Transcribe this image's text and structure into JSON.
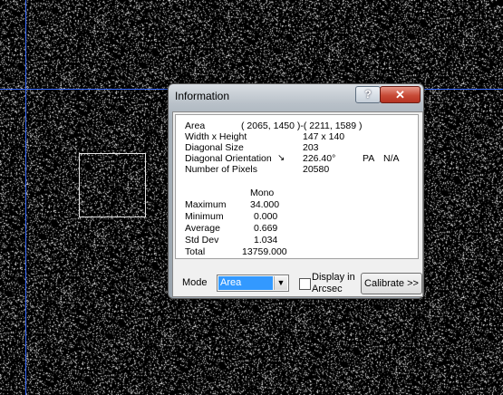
{
  "canvas": {
    "guide_color": "#3a6cff"
  },
  "dialog": {
    "title": "Information",
    "help_label": "?",
    "close_label": "✕",
    "rows": [
      {
        "label": "Area",
        "value": "( 2065, 1450 )-( 2211, 1589 )"
      },
      {
        "label": "Width x Height",
        "value": "147 x 140"
      },
      {
        "label": "Diagonal Size",
        "value": "203"
      },
      {
        "label": "Diagonal Orientation",
        "value": "226.40°",
        "extra1": "PA",
        "extra2": "N/A"
      },
      {
        "label": "Number of Pixels",
        "value": "20580"
      }
    ],
    "stats_header": "Mono",
    "stats": [
      {
        "label": "Maximum",
        "value": "34.000"
      },
      {
        "label": "Minimum",
        "value": "0.000"
      },
      {
        "label": "Average",
        "value": "0.669"
      },
      {
        "label": "Std Dev",
        "value": "1.034"
      },
      {
        "label": "Total",
        "value": "13759.000"
      }
    ],
    "mode_label": "Mode",
    "mode_value": "Area",
    "display_arcsec_line1": "Display in",
    "display_arcsec_line2": "Arcsec",
    "display_arcsec_checked": false,
    "calibrate_label": "Calibrate >>"
  }
}
